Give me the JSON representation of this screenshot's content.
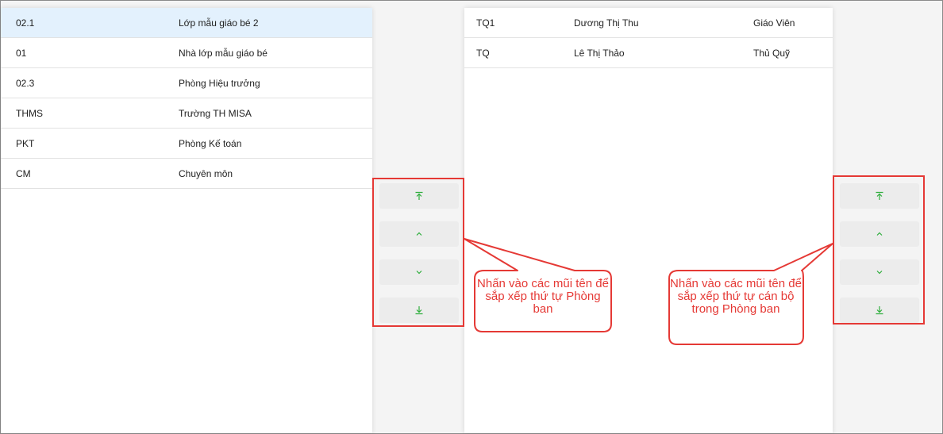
{
  "left_list": {
    "rows": [
      {
        "code": "02.1",
        "name": "Lớp mẫu giáo bé 2",
        "selected": true
      },
      {
        "code": "01",
        "name": "Nhà lớp mẫu giáo bé"
      },
      {
        "code": "02.3",
        "name": "Phòng Hiệu trưởng"
      },
      {
        "code": "THMS",
        "name": "Trường TH MISA"
      },
      {
        "code": "PKT",
        "name": "Phòng Kế toán"
      },
      {
        "code": "CM",
        "name": "Chuyên môn"
      }
    ]
  },
  "right_list": {
    "rows": [
      {
        "code": "TQ1",
        "name": "Dương Thị Thu",
        "position": "Giáo Viên"
      },
      {
        "code": "TQ",
        "name": "Lê Thị Thảo",
        "position": "Thủ Quỹ"
      }
    ]
  },
  "sort_buttons": {
    "icons": [
      "move-to-top-icon",
      "move-up-icon",
      "move-down-icon",
      "move-to-bottom-icon"
    ]
  },
  "callouts": {
    "left": "Nhấn vào các mũi tên để sắp xếp thứ tự Phòng ban",
    "right": "Nhấn vào các mũi tên để sắp xếp thứ tự cán bộ trong Phòng ban"
  },
  "colors": {
    "selected_row": "#e3f1fd",
    "arrow_green": "#2eae3c",
    "annotation_red": "#e53935"
  }
}
